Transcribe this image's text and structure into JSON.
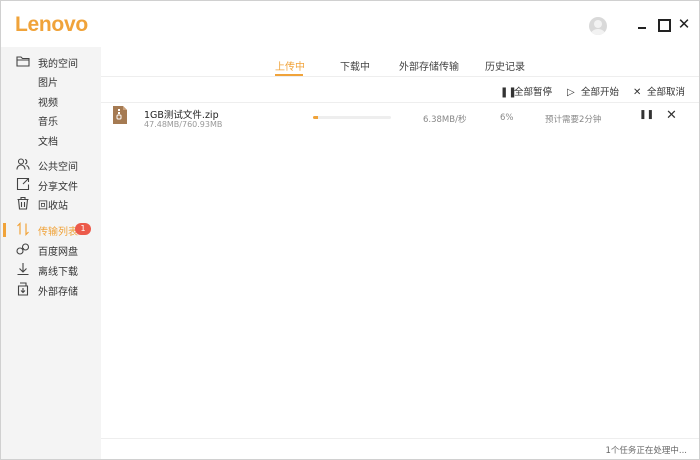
{
  "app": {
    "logo": "Lenovo"
  },
  "window": {
    "close_glyph": "✕"
  },
  "sidebar": {
    "my_space": "我的空间",
    "sub_items": [
      "图片",
      "视频",
      "音乐",
      "文档"
    ],
    "items": [
      {
        "label": "公共空间",
        "icon": "people-icon"
      },
      {
        "label": "分享文件",
        "icon": "share-icon"
      },
      {
        "label": "回收站",
        "icon": "trash-icon"
      },
      {
        "label": "传输列表",
        "icon": "transfer-icon",
        "badge": "1",
        "active": true
      },
      {
        "label": "百度网盘",
        "icon": "baidu-cloud-icon"
      },
      {
        "label": "离线下载",
        "icon": "download-icon"
      },
      {
        "label": "外部存储",
        "icon": "external-storage-icon"
      }
    ]
  },
  "tabs": [
    "上传中",
    "下载中",
    "外部存储传输",
    "历史记录"
  ],
  "toolbar": {
    "pause_all": "全部暂停",
    "start_all": "全部开始",
    "cancel_all": "全部取消"
  },
  "transfer": {
    "file_name": "1GB测试文件.zip",
    "size": "47.48MB/760.93MB",
    "progress_percent": 6,
    "speed": "6.38MB/秒",
    "percent_label": "6%",
    "eta": "预计需要2分钟"
  },
  "status": {
    "text": "1个任务正在处理中..."
  },
  "colors": {
    "accent": "#f0a33a",
    "badge": "#ec5a4a"
  }
}
